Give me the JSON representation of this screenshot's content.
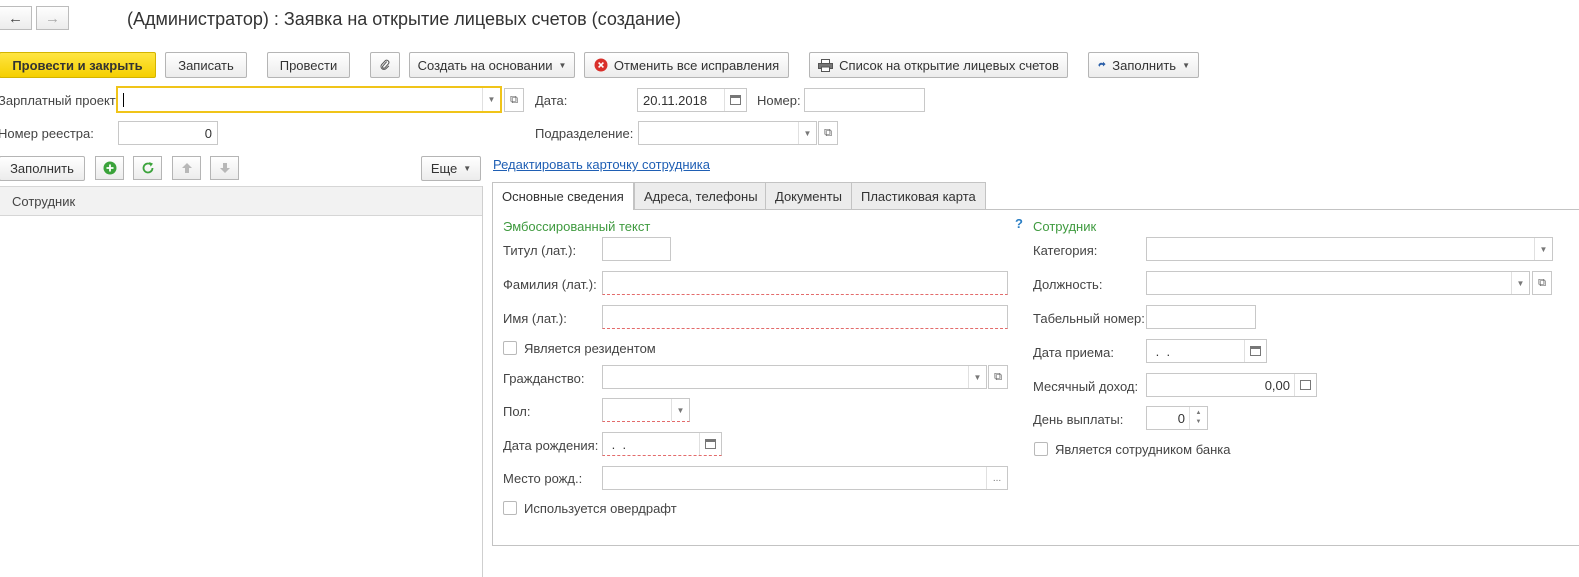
{
  "window": {
    "title": "(Администратор) : Заявка на открытие лицевых счетов (создание)",
    "back_icon": "←",
    "forward_icon": "→"
  },
  "toolbar": {
    "post_close": "Провести и закрыть",
    "save": "Записать",
    "post": "Провести",
    "create_based": "Создать на основании",
    "cancel_corrections": "Отменить все исправления",
    "list_accounts": "Список на открытие лицевых счетов",
    "fill": "Заполнить"
  },
  "header": {
    "salary_project_label": "Зарплатный проект:",
    "salary_project_value": "",
    "date_label": "Дата:",
    "date_value": "20.11.2018",
    "number_label": "Номер:",
    "number_value": "",
    "registry_label": "Номер реестра:",
    "registry_value": "0",
    "division_label": "Подразделение:",
    "division_value": ""
  },
  "list_panel": {
    "fill_button": "Заполнить",
    "more_button": "Еще",
    "column_employee": "Сотрудник",
    "rows": []
  },
  "edit_card_link": "Редактировать карточку сотрудника",
  "tabs": [
    {
      "label": "Основные сведения",
      "active": true
    },
    {
      "label": "Адреса, телефоны",
      "active": false
    },
    {
      "label": "Документы",
      "active": false
    },
    {
      "label": "Пластиковая карта",
      "active": false
    }
  ],
  "embossed": {
    "section_title": "Эмбоссированный текст",
    "title_lat_label": "Титул (лат.):",
    "title_lat_value": "",
    "surname_lat_label": "Фамилия (лат.):",
    "surname_lat_value": "",
    "name_lat_label": "Имя (лат.):",
    "name_lat_value": "",
    "resident_label": "Является резидентом",
    "resident_checked": false,
    "citizenship_label": "Гражданство:",
    "citizenship_value": "",
    "gender_label": "Пол:",
    "gender_value": "",
    "birth_date_label": "Дата рождения:",
    "birth_date_value": " .  .",
    "birth_place_label": "Место рожд.:",
    "birth_place_value": "",
    "birth_place_btn": "...",
    "overdraft_label": "Используется овердрафт",
    "overdraft_checked": false
  },
  "help_mark": "?",
  "employee": {
    "section_title": "Сотрудник",
    "category_label": "Категория:",
    "category_value": "",
    "position_label": "Должность:",
    "position_value": "",
    "tab_number_label": "Табельный номер:",
    "tab_number_value": "",
    "hire_date_label": "Дата приема:",
    "hire_date_value": " .  .",
    "monthly_income_label": "Месячный доход:",
    "monthly_income_value": "0,00",
    "pay_day_label": "День выплаты:",
    "pay_day_value": "0",
    "bank_employee_label": "Является сотрудником банка",
    "bank_employee_checked": false
  },
  "colors": {
    "primary_button": "#f5cf00",
    "section_title": "#3f9a3f",
    "link": "#1f5fb4",
    "focus_border": "#f0c419",
    "required_underline": "#e36b6b"
  }
}
